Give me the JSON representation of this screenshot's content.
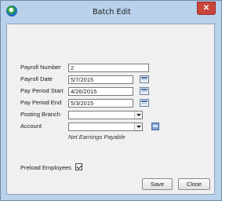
{
  "window": {
    "title": "Batch Edit",
    "close_label": "✕"
  },
  "form": {
    "payroll_number": {
      "label": "Payroll Number",
      "value": "2"
    },
    "payroll_date": {
      "label": "Payroll Date",
      "value": "5/7/2015"
    },
    "pay_period_start": {
      "label": "Pay Period Start",
      "value": "4/26/2015"
    },
    "pay_period_end": {
      "label": "Pay Period End",
      "value": "5/3/2015"
    },
    "posting_branch": {
      "label": "Posting Branch",
      "value": ""
    },
    "account": {
      "label": "Account",
      "value": "",
      "hint": "Net Earnings Payable"
    },
    "preload_employees": {
      "label": "Preload Employees",
      "checked": true
    }
  },
  "buttons": {
    "save": "Save",
    "close": "Close"
  },
  "colors": {
    "frame": "#b9d1ea",
    "client": "#f0f0f0",
    "close_button": "#c9463d"
  }
}
